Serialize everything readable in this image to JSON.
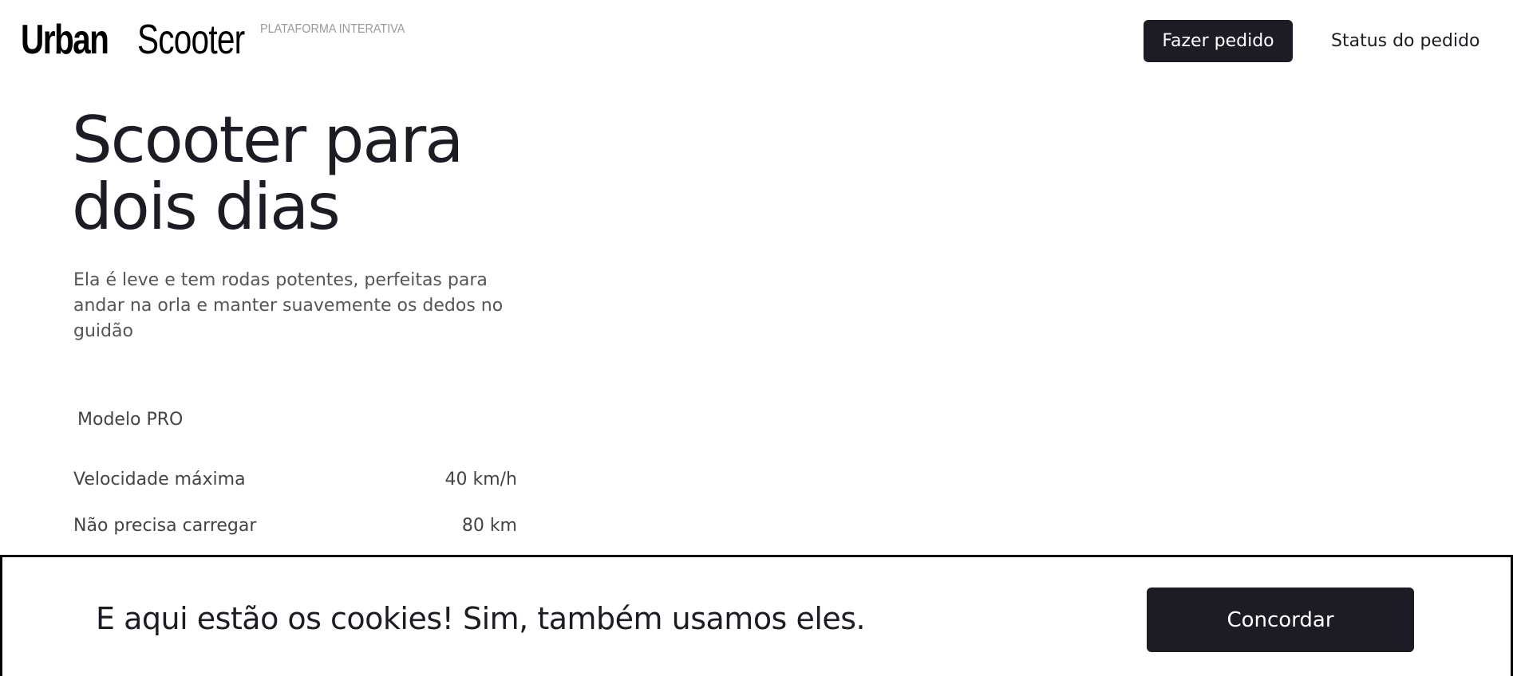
{
  "header": {
    "logo_primary": "Urban",
    "logo_secondary": "Scooter",
    "logo_tagline": "PLATAFORMA INTERATIVA",
    "order_button_label": "Fazer pedido",
    "status_link_label": "Status do pedido"
  },
  "hero": {
    "title_line1": "Scooter para",
    "title_line2": "dois dias",
    "description": "Ela é leve e tem rodas potentes, perfeitas para andar na orla e manter suavemente os dedos no guidão"
  },
  "specs": {
    "model_name": "Modelo PRO",
    "rows": [
      {
        "label": "Velocidade máxima",
        "value": "40 km/h"
      },
      {
        "label": "Não precisa carregar",
        "value": "80 km"
      }
    ]
  },
  "cookie_banner": {
    "message": "E aqui estão os cookies! Sim, também usamos eles.",
    "agree_button_label": "Concordar"
  },
  "colors": {
    "primary_dark": "#1d1c24",
    "background": "#ffffff",
    "muted_text": "#555555",
    "tagline_gray": "#9a9a9a"
  }
}
